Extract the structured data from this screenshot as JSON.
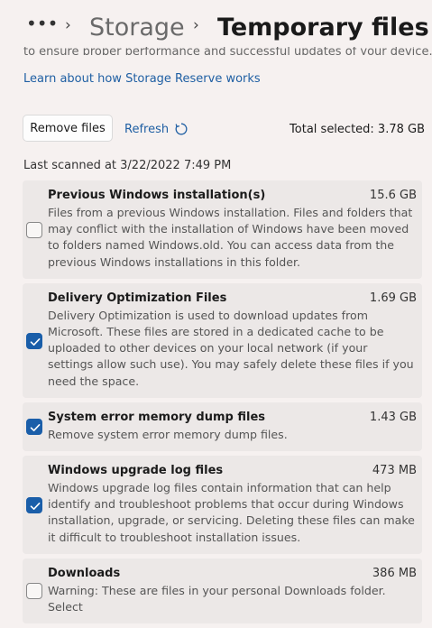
{
  "header": {
    "more_icon": "more-dots-icon",
    "parent": "Storage",
    "current": "Temporary files"
  },
  "intro_cut": "to ensure proper performance and successful updates of your device.",
  "learn_link": "Learn about how Storage Reserve works",
  "toolbar": {
    "remove_label": "Remove files",
    "refresh_label": "Refresh",
    "refresh_icon": "refresh-icon",
    "total_selected": "Total selected: 3.78 GB"
  },
  "last_scanned": "Last scanned at 3/22/2022 7:49 PM",
  "accent": "#1a5ea9",
  "items": [
    {
      "title": "Previous Windows installation(s)",
      "size": "15.6 GB",
      "checked": false,
      "desc": "Files from a previous Windows installation.  Files and folders that may conflict with the installation of Windows have been moved to folders named Windows.old.  You can access data from the previous Windows installations in this folder."
    },
    {
      "title": "Delivery Optimization Files",
      "size": "1.69 GB",
      "checked": true,
      "desc": "Delivery Optimization is used to download updates from Microsoft. These files are stored in a dedicated cache to be uploaded to other devices on your local network (if your settings allow such use). You may safely delete these files if you need the space."
    },
    {
      "title": "System error memory dump files",
      "size": "1.43 GB",
      "checked": true,
      "desc": "Remove system error memory dump files."
    },
    {
      "title": "Windows upgrade log files",
      "size": "473 MB",
      "checked": true,
      "desc": "Windows upgrade log files contain information that can help identify and troubleshoot problems that occur during Windows installation, upgrade, or servicing.  Deleting these files can make it difficult to troubleshoot installation issues."
    },
    {
      "title": "Downloads",
      "size": "386 MB",
      "checked": false,
      "desc": "Warning: These are files in your personal Downloads folder. Select"
    }
  ]
}
